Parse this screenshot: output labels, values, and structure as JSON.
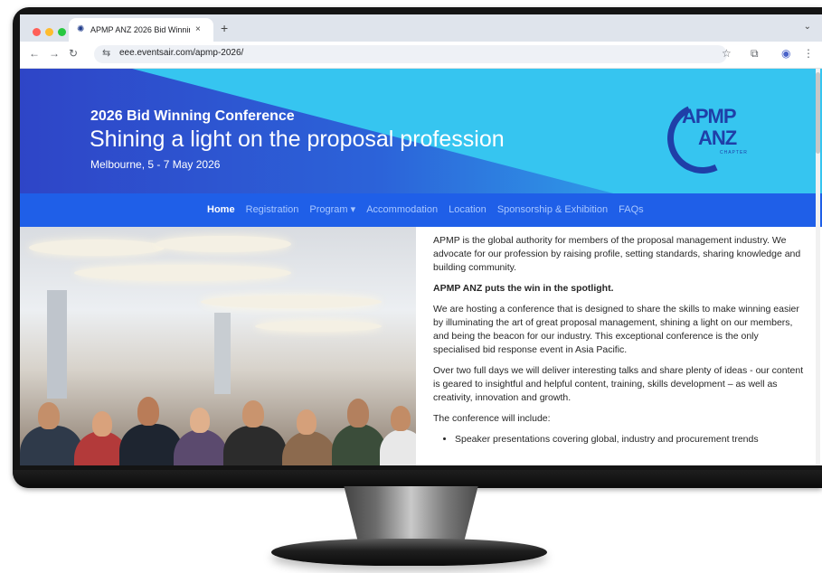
{
  "browser": {
    "tab_title": "APMP ANZ 2026 Bid Winnin",
    "tab_close": "×",
    "new_tab": "+",
    "url": "eee.eventsair.com/apmp-2026/",
    "back": "←",
    "forward": "→",
    "reload": "↻",
    "site_icon": "⇆",
    "bookmark": "☆",
    "extensions": "⧉",
    "profile": "◉",
    "menu": "⋮",
    "tab_menu": "⌄"
  },
  "hero": {
    "kicker": "2026 Bid Winning Conference",
    "headline": "Shining a light on the proposal profession",
    "dates": "Melbourne, 5 - 7 May 2026",
    "logo_line1": "APMP",
    "logo_line2": "ANZ",
    "logo_line3": "CHAPTER"
  },
  "nav": {
    "items": [
      "Home",
      "Registration",
      "Program ▾",
      "Accommodation",
      "Location",
      "Sponsorship & Exhibition",
      "FAQs"
    ]
  },
  "article": {
    "p1": "APMP is the global authority for members of the proposal management industry. We advocate for our profession by raising profile, setting standards, sharing knowledge and building community.",
    "p2": "APMP ANZ puts the win in the spotlight.",
    "p3": "We are hosting a conference that is designed to share the skills to make winning easier by illuminating the art of great proposal management, shining a light on our members, and being the beacon for our industry. This exceptional conference is the only specialised bid response event in Asia Pacific.",
    "p4": "Over two full days we will deliver interesting talks and share plenty of ideas - our content is geared to insightful and helpful content, training, skills development – as well as creativity, innovation and growth.",
    "p5": "The conference will include:",
    "bullet1": "Speaker presentations covering global, industry and procurement trends"
  },
  "colors": {
    "hero_light": "#36c5f0",
    "hero_dark": "#2e45c7",
    "nav_bg": "#1f5fe8",
    "logo": "#1f3fa8"
  }
}
